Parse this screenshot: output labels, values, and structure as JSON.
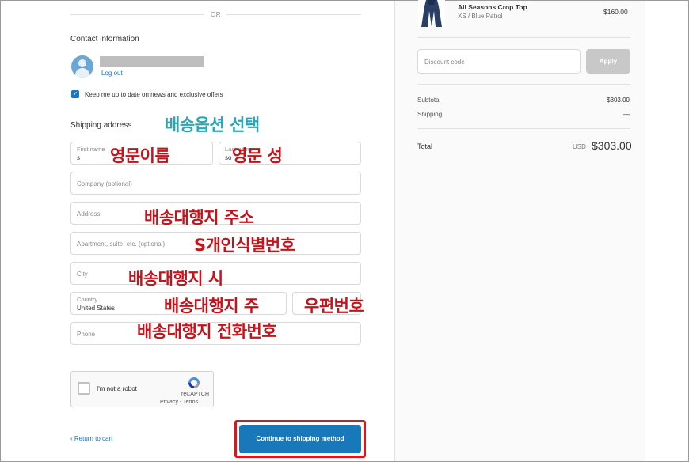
{
  "divider": {
    "label": "OR"
  },
  "contact": {
    "title": "Contact information",
    "logout_label": "Log out",
    "marketing_optin_label": "Keep me up to date on news and exclusive offers",
    "marketing_optin_checked": true
  },
  "shipping": {
    "title": "Shipping address",
    "first_name": {
      "label": "First name",
      "value": "s"
    },
    "last_name": {
      "label": "Last name",
      "value": "so"
    },
    "company": {
      "placeholder": "Company (optional)"
    },
    "address": {
      "placeholder": "Address"
    },
    "apartment": {
      "placeholder": "Apartment, suite, etc. (optional)"
    },
    "city": {
      "placeholder": "City"
    },
    "country": {
      "label": "Country",
      "value": "United States"
    },
    "phone": {
      "placeholder": "Phone"
    }
  },
  "annotations": {
    "shipping_option": "배송옵션 선택",
    "english_first_name": "영문이름",
    "english_last_name": "영문 성",
    "forwarder_address": "배송대행지 주소",
    "personal_id": "S개인식별번호",
    "forwarder_city": "배송대행지 시",
    "forwarder_state": "배송대행지 주",
    "postal_code": "우편번호",
    "forwarder_phone": "배송대행지 전화번호"
  },
  "captcha": {
    "label": "I'm not a robot",
    "brand": "reCAPTCH",
    "links": "Privacy - Terms"
  },
  "footer": {
    "return_label": "‹ Return to cart",
    "continue_label": "Continue to shipping method"
  },
  "order": {
    "product": {
      "name": "All Seasons Crop Top",
      "variant": "XS / Blue Patrol",
      "price": "$160.00"
    },
    "discount": {
      "placeholder": "Discount code",
      "apply_label": "Apply"
    },
    "subtotal_label": "Subtotal",
    "subtotal_value": "$303.00",
    "shipping_label": "Shipping",
    "shipping_value": "—",
    "total_label": "Total",
    "total_currency": "USD",
    "total_value": "$303.00"
  },
  "colors": {
    "accent": "#1878b9",
    "annotation_red": "#c4131a",
    "annotation_teal": "#2aa7b5",
    "highlight_border": "#e0141b"
  }
}
